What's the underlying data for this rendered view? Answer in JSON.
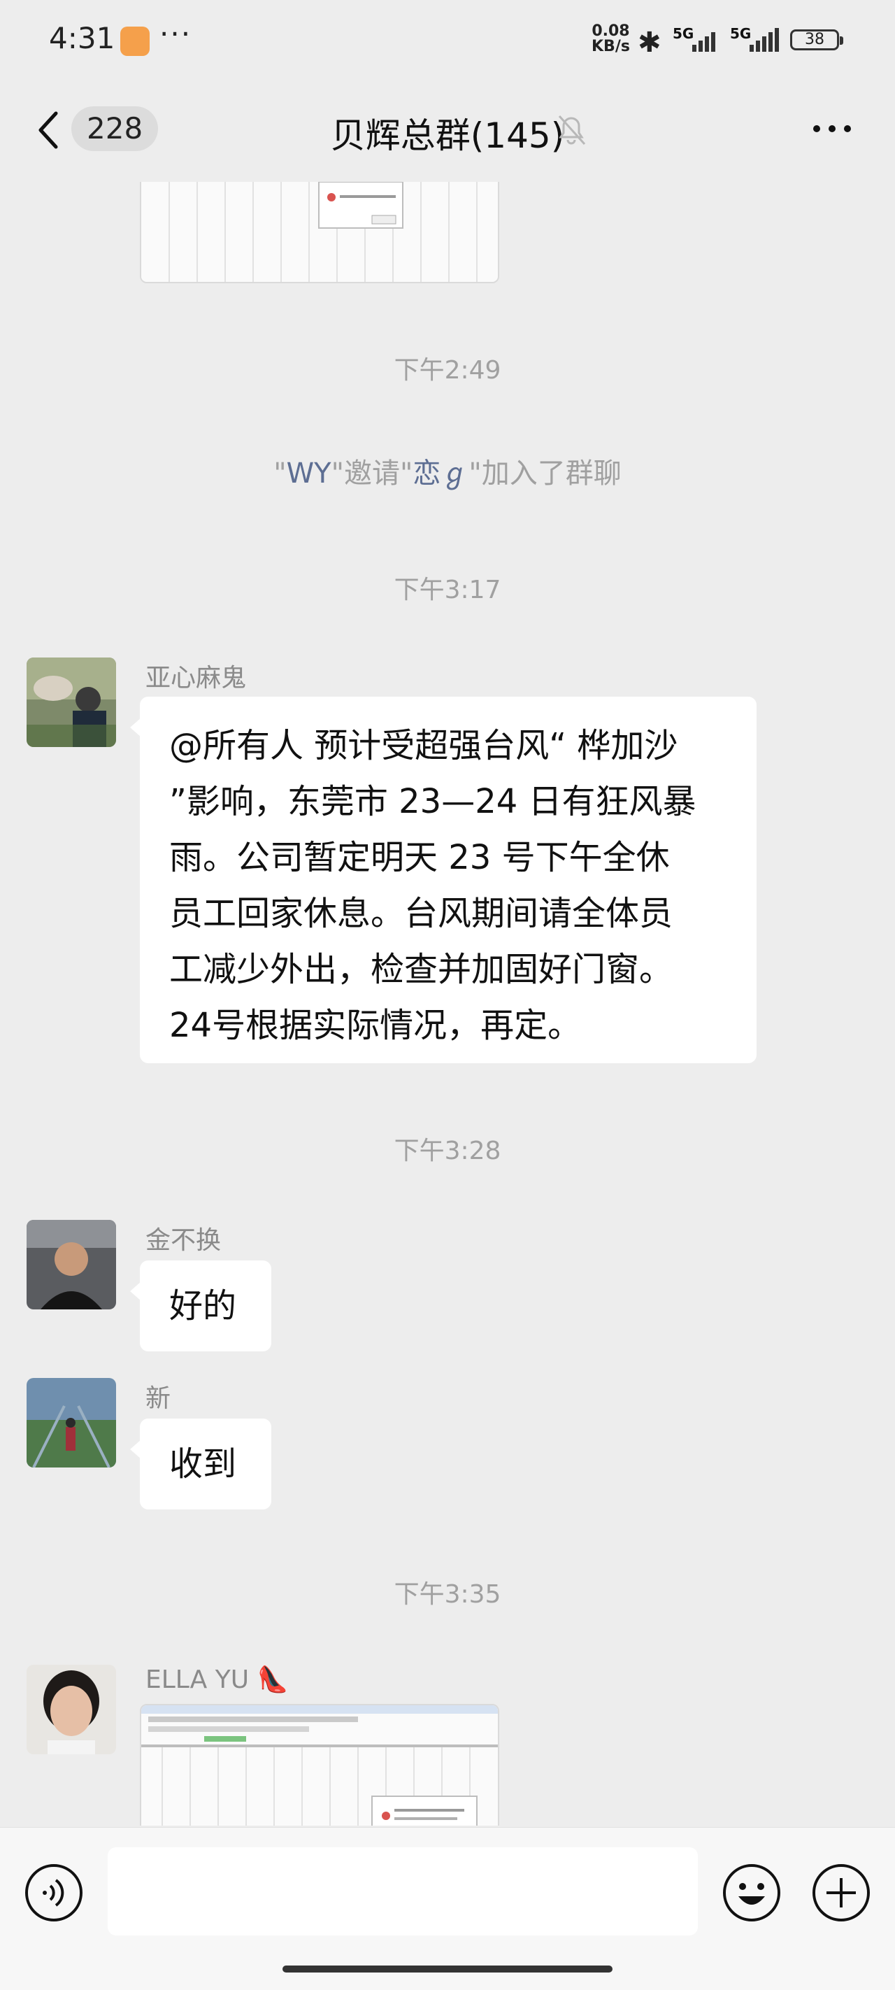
{
  "status_bar": {
    "time": "4:31",
    "more": "···",
    "net_speed_value": "0.08",
    "net_speed_unit": "KB/s",
    "signal1_label": "5G",
    "signal2_label": "5G",
    "battery": "38"
  },
  "header": {
    "unread_count": "228",
    "title": "贝辉总群(145)"
  },
  "messages": {
    "time_249": "下午2:49",
    "system_join": {
      "q1": "\"",
      "inviter": "WY",
      "q2": "\"邀请\"",
      "invitee": "恋ℊ",
      "q3": "\"加入了群聊"
    },
    "time_317": "下午3:17",
    "msg1": {
      "sender": "亚心麻鬼",
      "lines": [
        "@所有人  预计受超强台风“ 桦加沙",
        "”影响，东莞市 23—24 日有狂风暴",
        "雨。公司暂定明天 23 号下午全休",
        "员工回家休息。台风期间请全体员",
        "工减少外出，检查并加固好门窗。",
        "24号根据实际情况，再定。"
      ]
    },
    "time_328": "下午3:28",
    "msg2": {
      "sender": "金不换",
      "text": "好的"
    },
    "msg3": {
      "sender": "新",
      "text": "收到"
    },
    "time_335": "下午3:35",
    "msg4": {
      "sender": "ELLA YU 👠"
    }
  },
  "input": {
    "placeholder": ""
  },
  "colors": {
    "background": "#EDEDED",
    "bubble": "#FFFFFF",
    "system_name": "#5D6E93",
    "meta_text": "#A0A0A0"
  }
}
